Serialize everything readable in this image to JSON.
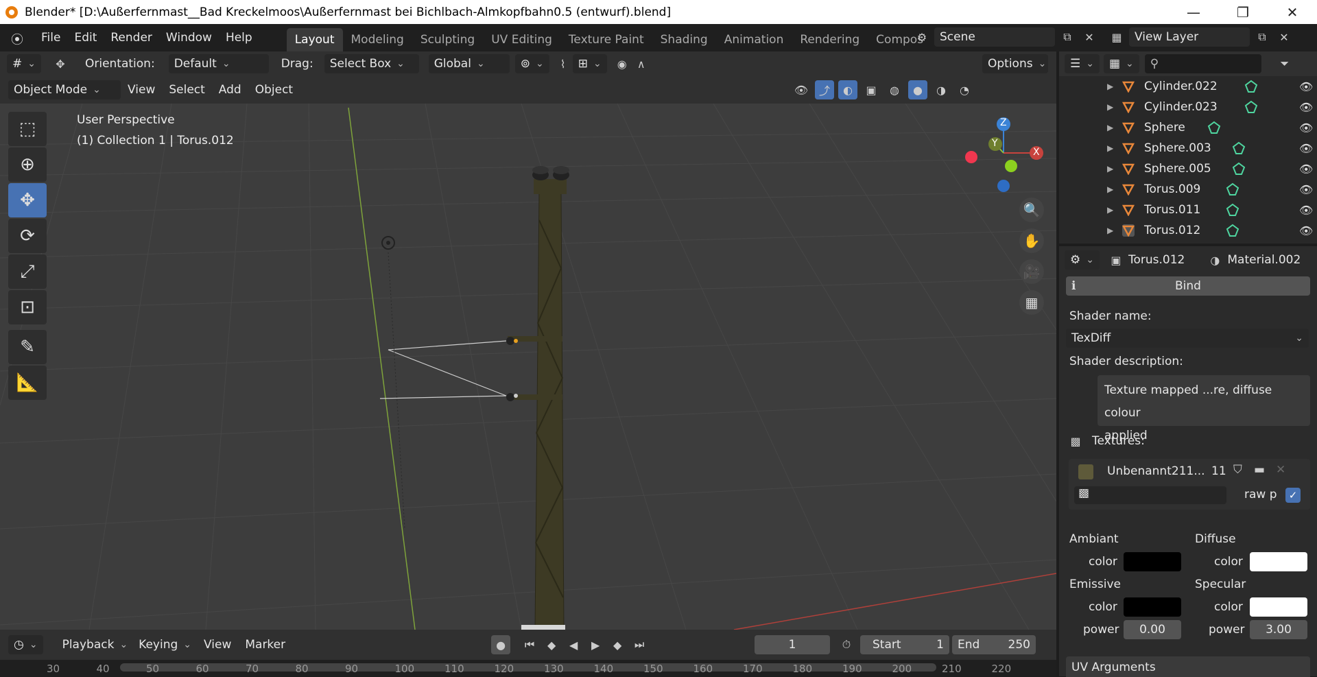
{
  "window": {
    "title": "Blender* [D:\\Außerfernmast__Bad Kreckelmoos\\Außerfernmast bei Bichlbach-Almkopfbahn0.5 (entwurf).blend]",
    "minimize": "—",
    "restore": "❐",
    "close": "✕"
  },
  "menu": [
    "File",
    "Edit",
    "Render",
    "Window",
    "Help"
  ],
  "workspaces": [
    "Layout",
    "Modeling",
    "Sculpting",
    "UV Editing",
    "Texture Paint",
    "Shading",
    "Animation",
    "Rendering",
    "Compos"
  ],
  "scene": {
    "name": "Scene",
    "view_layer": "View Layer"
  },
  "header": {
    "orientation_label": "Orientation:",
    "orientation_value": "Default",
    "drag_label": "Drag:",
    "drag_value": "Select Box",
    "transform_value": "Global",
    "options": "Options",
    "mode": "Object Mode",
    "view": "View",
    "select": "Select",
    "add": "Add",
    "object": "Object"
  },
  "viewport": {
    "perspective": "User Perspective",
    "collection_info": "(1) Collection 1 | Torus.012",
    "gizmo_axes": {
      "z": "Z",
      "y": "Y",
      "x": "X"
    },
    "colors": {
      "background": "#3d3d3d",
      "x_axis": "#c8433d",
      "y_axis": "#8cc13b",
      "z_axis": "#3b83d6"
    }
  },
  "timeline": {
    "playback": "Playback",
    "keying": "Keying",
    "view": "View",
    "marker": "Marker",
    "current_frame": "1",
    "start_label": "Start",
    "start_value": "1",
    "end_label": "End",
    "end_value": "250",
    "ruler": [
      "30",
      "40",
      "50",
      "60",
      "70",
      "80",
      "90",
      "100",
      "110",
      "120",
      "130",
      "140",
      "150",
      "160",
      "170",
      "180",
      "190",
      "200",
      "210",
      "220"
    ]
  },
  "outliner": {
    "items": [
      {
        "name": "Cylinder.022"
      },
      {
        "name": "Cylinder.023"
      },
      {
        "name": "Sphere"
      },
      {
        "name": "Sphere.003"
      },
      {
        "name": "Sphere.005"
      },
      {
        "name": "Torus.009"
      },
      {
        "name": "Torus.011"
      },
      {
        "name": "Torus.012"
      }
    ]
  },
  "properties": {
    "object": "Torus.012",
    "material": "Material.002",
    "bind": "Bind",
    "shader_name_label": "Shader name:",
    "shader_name": "TexDiff",
    "shader_desc_label": "Shader description:",
    "shader_desc_1": "Texture mapped ...re, diffuse colour",
    "shader_desc_2": "applied",
    "textures_label": "Textures:",
    "texture_name": "Unbenannt211...",
    "texture_users": "11",
    "raw_label": "raw p",
    "ambiant": "Ambiant",
    "diffuse": "Diffuse",
    "emissive": "Emissive",
    "specular": "Specular",
    "color": "color",
    "power": "power",
    "emissive_power": "0.00",
    "specular_power": "3.00",
    "uv_args": "UV Arguments",
    "colors": {
      "ambiant": "#000000",
      "diffuse": "#ffffff",
      "emissive": "#000000",
      "specular": "#ffffff",
      "texture_swatch": "#5e5a3a"
    }
  }
}
